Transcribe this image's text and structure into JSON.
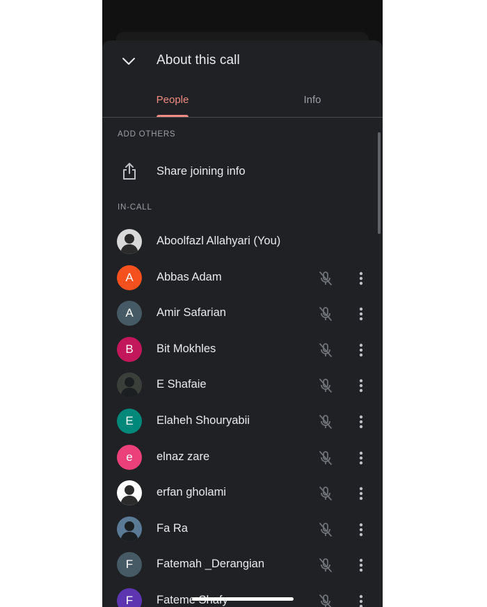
{
  "sheet": {
    "title": "About this call",
    "collapse_icon": "chevron-down-icon"
  },
  "tabs": [
    {
      "label": "People",
      "active": true
    },
    {
      "label": "Info",
      "active": false
    }
  ],
  "colors": {
    "sheet_background": "#202124",
    "accent": "#f28b82",
    "text_primary": "#e8eaed",
    "text_secondary": "#9aa0a6"
  },
  "add_others": {
    "label": "ADD OTHERS",
    "share": {
      "label": "Share joining info",
      "icon": "share-icon"
    }
  },
  "in_call": {
    "label": "IN-CALL",
    "people": [
      {
        "name": "Aboolfazl Allahyari (You)",
        "initial": "",
        "avatar_color": "#d9d9d9",
        "avatar_type": "photo",
        "muted": false,
        "has_menu": false
      },
      {
        "name": "Abbas Adam",
        "initial": "A",
        "avatar_color": "#f4511e",
        "avatar_type": "letter",
        "muted": true,
        "has_menu": true
      },
      {
        "name": "Amir Safarian",
        "initial": "A",
        "avatar_color": "#455a64",
        "avatar_type": "letter",
        "muted": true,
        "has_menu": true
      },
      {
        "name": "Bit Mokhles",
        "initial": "B",
        "avatar_color": "#c2185b",
        "avatar_type": "letter",
        "muted": true,
        "has_menu": true
      },
      {
        "name": "E Shafaie",
        "initial": "",
        "avatar_color": "#3a3f3a",
        "avatar_type": "photo",
        "muted": true,
        "has_menu": true
      },
      {
        "name": "Elaheh Shouryabii",
        "initial": "E",
        "avatar_color": "#00897b",
        "avatar_type": "letter",
        "muted": true,
        "has_menu": true
      },
      {
        "name": "elnaz zare",
        "initial": "e",
        "avatar_color": "#ec407a",
        "avatar_type": "letter",
        "muted": true,
        "has_menu": true
      },
      {
        "name": "erfan gholami",
        "initial": "",
        "avatar_color": "#ffffff",
        "avatar_type": "photo",
        "muted": true,
        "has_menu": true
      },
      {
        "name": "Fa Ra",
        "initial": "",
        "avatar_color": "#5b7a96",
        "avatar_type": "photo",
        "muted": true,
        "has_menu": true
      },
      {
        "name": "Fatemah _Derangian",
        "initial": "F",
        "avatar_color": "#455a64",
        "avatar_type": "letter",
        "muted": true,
        "has_menu": true
      },
      {
        "name": "Fateme Shafy",
        "initial": "F",
        "avatar_color": "#5e35b1",
        "avatar_type": "letter",
        "muted": true,
        "has_menu": true
      }
    ]
  },
  "icons": {
    "mic_off": "mic-off-icon",
    "more": "more-vert-icon"
  }
}
